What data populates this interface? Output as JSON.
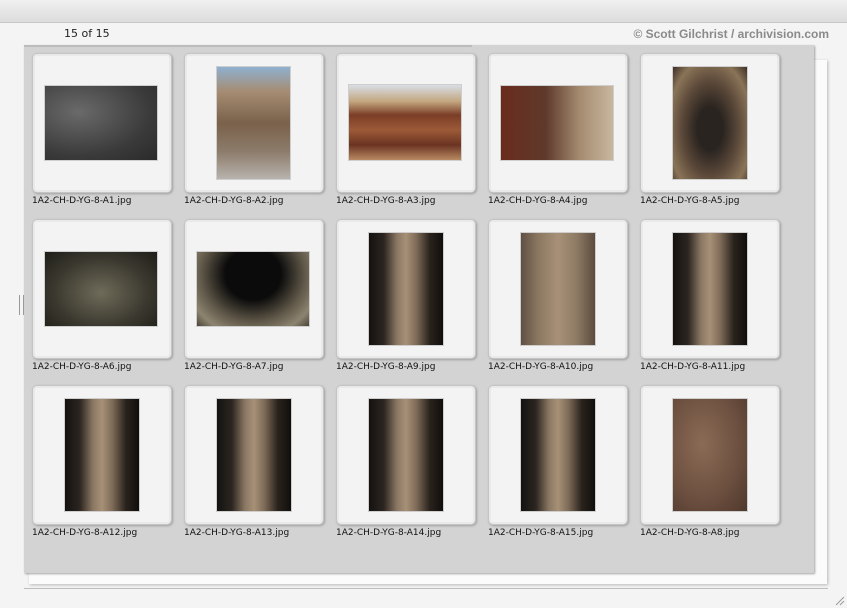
{
  "window": {
    "counter": "15 of 15",
    "credit": "© Scott Gilchrist / archivision.com"
  },
  "thumbnails": [
    {
      "filename": "1A2-CH-D-YG-8-A1.jpg",
      "icon": "stone-plaque-photo"
    },
    {
      "filename": "1A2-CH-D-YG-8-A2.jpg",
      "icon": "cliff-pavilion-photo"
    },
    {
      "filename": "1A2-CH-D-YG-8-A3.jpg",
      "icon": "wooden-pavilion-photo"
    },
    {
      "filename": "1A2-CH-D-YG-8-A4.jpg",
      "icon": "temple-entrance-photo"
    },
    {
      "filename": "1A2-CH-D-YG-8-A5.jpg",
      "icon": "cave-entrance-photo"
    },
    {
      "filename": "1A2-CH-D-YG-8-A6.jpg",
      "icon": "buddha-relief-photo"
    },
    {
      "filename": "1A2-CH-D-YG-8-A7.jpg",
      "icon": "cave-ceiling-photo"
    },
    {
      "filename": "1A2-CH-D-YG-8-A9.jpg",
      "icon": "carved-pillar-photo"
    },
    {
      "filename": "1A2-CH-D-YG-8-A10.jpg",
      "icon": "carved-pillar-photo"
    },
    {
      "filename": "1A2-CH-D-YG-8-A11.jpg",
      "icon": "carved-pillar-photo"
    },
    {
      "filename": "1A2-CH-D-YG-8-A12.jpg",
      "icon": "carved-pillar-photo"
    },
    {
      "filename": "1A2-CH-D-YG-8-A13.jpg",
      "icon": "carved-pillar-photo"
    },
    {
      "filename": "1A2-CH-D-YG-8-A14.jpg",
      "icon": "carved-pillar-photo"
    },
    {
      "filename": "1A2-CH-D-YG-8-A15.jpg",
      "icon": "carved-pillar-photo"
    },
    {
      "filename": "1A2-CH-D-YG-8-A8.jpg",
      "icon": "carved-wall-photo"
    }
  ]
}
